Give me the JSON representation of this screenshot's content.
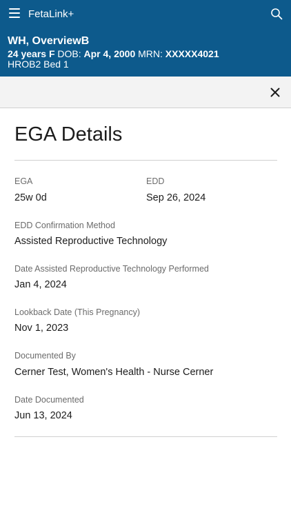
{
  "app": {
    "title": "FetaLink+"
  },
  "patient": {
    "name": "WH, OverviewB",
    "age_sex": "24 years F",
    "dob_label": "DOB:",
    "dob": "Apr 4, 2000",
    "mrn_label": "MRN:",
    "mrn": "XXXXX4021",
    "location": "HROB2 Bed 1"
  },
  "details": {
    "title": "EGA Details",
    "ega_label": "EGA",
    "ega_value": "25w 0d",
    "edd_label": "EDD",
    "edd_value": "Sep 26, 2024",
    "confirm_label": "EDD Confirmation Method",
    "confirm_value": "Assisted Reproductive Technology",
    "art_date_label": "Date Assisted Reproductive Technology Performed",
    "art_date_value": "Jan 4, 2024",
    "lookback_label": "Lookback Date (This Pregnancy)",
    "lookback_value": "Nov 1, 2023",
    "documented_by_label": "Documented By",
    "documented_by_value": "Cerner Test, Women's Health - Nurse Cerner",
    "date_documented_label": "Date Documented",
    "date_documented_value": "Jun 13, 2024"
  },
  "icons": {
    "menu": "hamburger-menu-icon",
    "search": "search-icon",
    "close": "close-icon"
  },
  "colors": {
    "header_bg": "#0d5a8c",
    "modal_bar_bg": "#f3f3f3"
  }
}
